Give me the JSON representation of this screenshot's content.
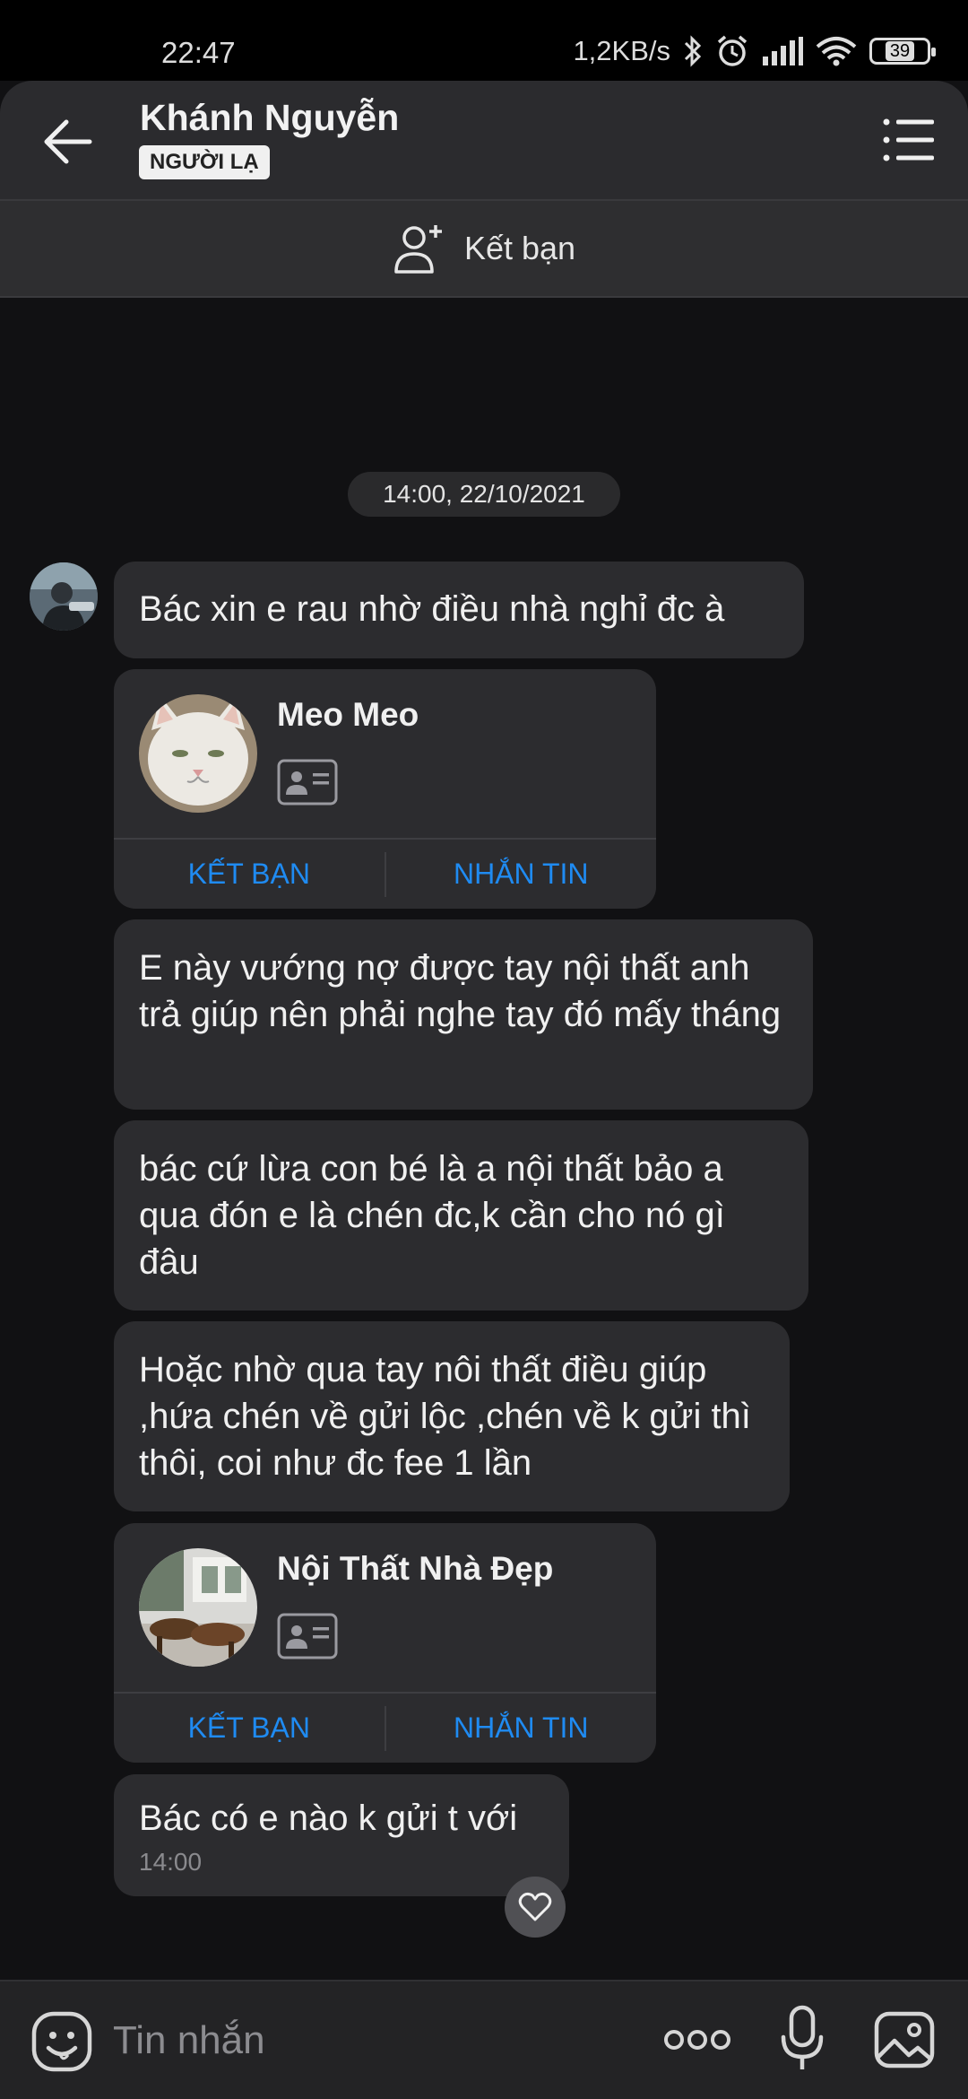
{
  "status_bar": {
    "time": "22:47",
    "network_speed": "1,2KB/s",
    "battery": "39",
    "icons": [
      "bluetooth-icon",
      "alarm-icon",
      "signal-icon",
      "wifi-icon",
      "battery-icon"
    ]
  },
  "header": {
    "name": "Khánh Nguyễn",
    "badge": "NGƯỜI LẠ",
    "icons": [
      "back-arrow-icon",
      "menu-list-icon"
    ]
  },
  "add_friend_bar": {
    "label": "Kết bạn",
    "icon": "add-user-icon"
  },
  "conversation": {
    "timestamp": "14:00, 22/10/2021",
    "messages": [
      {
        "type": "text",
        "text": "Bác xin e rau nhờ điều nhà nghỉ đc à"
      },
      {
        "type": "contact_card",
        "name": "Meo Meo",
        "add_label": "KẾT BẠN",
        "message_label": "NHẮN TIN"
      },
      {
        "type": "text",
        "text": "E này vướng nợ được tay nội thất anh trả giúp nên phải nghe tay đó mấy tháng"
      },
      {
        "type": "text",
        "text": "bác cứ lừa con bé là a nội thất bảo a qua đón e là chén đc,k cần cho nó gì đâu"
      },
      {
        "type": "text",
        "text": "Hoặc nhờ qua tay nôi thất điều giúp ,hứa chén về gửi lộc ,chén về k gửi thì thôi, coi như đc fee 1 lần"
      },
      {
        "type": "contact_card",
        "name": "Nội Thất Nhà Đẹp",
        "add_label": "KẾT BẠN",
        "message_label": "NHẮN TIN"
      },
      {
        "type": "text",
        "text": "Bác có e nào k gửi t với",
        "time": "14:00"
      }
    ]
  },
  "input_bar": {
    "placeholder": "Tin nhắn",
    "icons": [
      "emoji-icon",
      "more-dots-icon",
      "microphone-icon",
      "image-icon"
    ]
  },
  "colors": {
    "background": "#111113",
    "bubble": "#2c2c2f",
    "link_blue": "#1f8bf2",
    "header": "#2b2b2e"
  }
}
